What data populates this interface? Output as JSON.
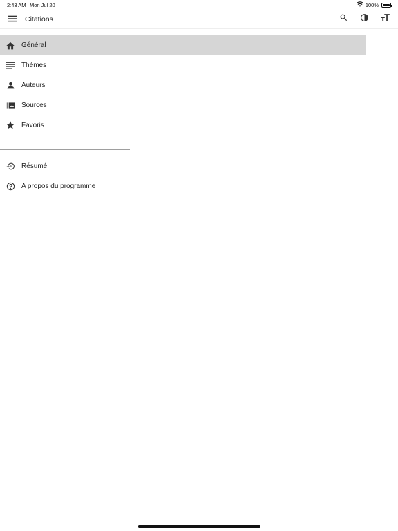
{
  "status": {
    "time": "2:43 AM",
    "date": "Mon Jul 20",
    "battery": "100%"
  },
  "app_bar": {
    "title": "Citations"
  },
  "drawer": {
    "items": [
      {
        "label": "Général",
        "icon": "home-icon",
        "selected": true
      },
      {
        "label": "Thèmes",
        "icon": "subject-icon",
        "selected": false
      },
      {
        "label": "Auteurs",
        "icon": "person-icon",
        "selected": false
      },
      {
        "label": "Sources",
        "icon": "library-icon",
        "selected": false
      },
      {
        "label": "Favoris",
        "icon": "star-icon",
        "selected": false
      }
    ],
    "secondary": [
      {
        "label": "Résumé",
        "icon": "history-icon"
      },
      {
        "label": "A propos du programme",
        "icon": "help-icon"
      }
    ]
  },
  "colors": {
    "selected_bg": "#d6d6d6",
    "icon": "#333333"
  }
}
